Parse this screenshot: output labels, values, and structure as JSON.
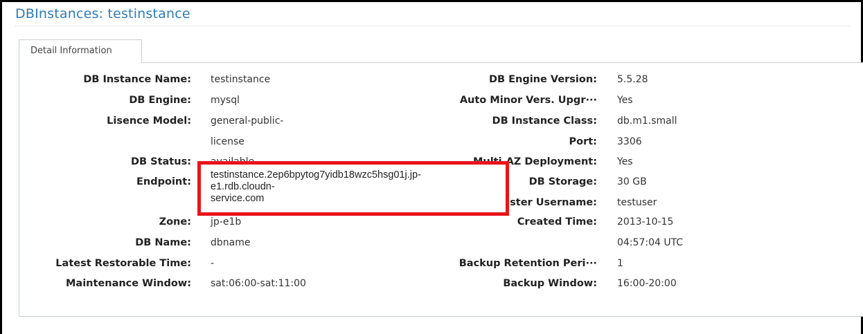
{
  "header": {
    "title": "DBInstances: testinstance"
  },
  "tabs": [
    {
      "label": "Detail Information",
      "active": true
    }
  ],
  "details_left": [
    {
      "label": "DB Instance Name:",
      "value": "testinstance"
    },
    {
      "label": "DB Engine:",
      "value": "mysql"
    },
    {
      "label": "Lisence Model:",
      "value": "general-public-",
      "value_line2": "license"
    },
    {
      "label": "DB Status:",
      "value": "available"
    },
    {
      "label": "Endpoint:",
      "value": "testinstance.2ep6bpytog7yidb18wzc5hsg01j.jp-e1.rdb.cloudn-service.com"
    },
    {
      "label": "Zone:",
      "value": "jp-e1b"
    },
    {
      "label": "DB Name:",
      "value": "dbname"
    },
    {
      "label": "Latest Restorable Time:",
      "value": "-"
    },
    {
      "label": "Maintenance Window:",
      "value": "sat:06:00-sat:11:00"
    }
  ],
  "endpoint_display_lines": [
    "testinstance.2ep6bpytog7yidb18wzc5hsg01j.jp-",
    "e1.rdb.cloudn-",
    "service.com"
  ],
  "details_right": [
    {
      "label": "DB Engine Version:",
      "value": "5.5.28"
    },
    {
      "label": "Auto Minor Vers. Upgr···",
      "value": "Yes"
    },
    {
      "label": "DB Instance Class:",
      "value": "db.m1.small"
    },
    {
      "label": "Port:",
      "value": "3306"
    },
    {
      "label": "Multi-AZ Deployment:",
      "value": "Yes"
    },
    {
      "label": "DB Storage:",
      "value": "30 GB"
    },
    {
      "label": "Master Username:",
      "value": "testuser"
    },
    {
      "label": "Created Time:",
      "value": "2013-10-15",
      "value_line2": "04:57:04 UTC"
    },
    {
      "label": "Backup Retention Peri···",
      "value": "1"
    },
    {
      "label": "Backup Window:",
      "value": "16:00-20:00"
    }
  ],
  "colors": {
    "title": "#2e7bb6",
    "highlight_border": "#e8141c"
  }
}
